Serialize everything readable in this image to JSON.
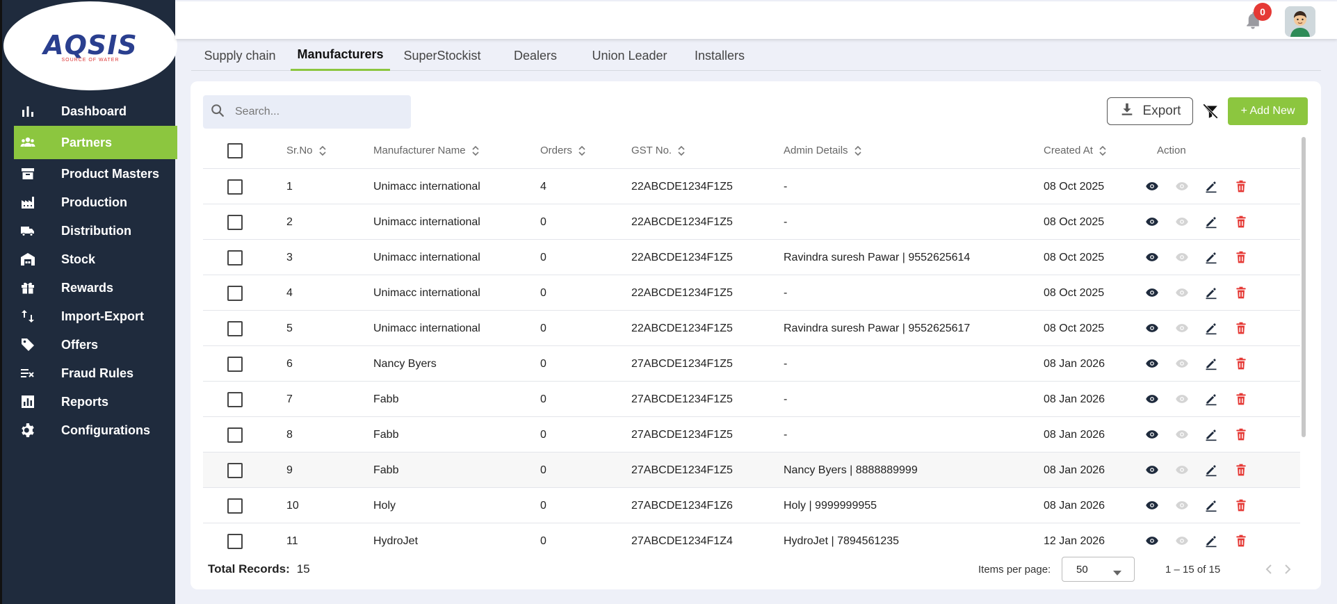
{
  "logo": {
    "text": "AQSIS",
    "tagline": "SOURCE OF WATER"
  },
  "sidebar": {
    "items": [
      {
        "label": "Dashboard",
        "icon": "bar-chart-icon"
      },
      {
        "label": "Partners",
        "icon": "group-icon",
        "active": true
      },
      {
        "label": "Product Masters",
        "icon": "archive-icon"
      },
      {
        "label": "Production",
        "icon": "factory-icon"
      },
      {
        "label": "Distribution",
        "icon": "truck-icon"
      },
      {
        "label": "Stock",
        "icon": "warehouse-icon"
      },
      {
        "label": "Rewards",
        "icon": "gift-icon"
      },
      {
        "label": "Import-Export",
        "icon": "import-export-icon"
      },
      {
        "label": "Offers",
        "icon": "tag-icon"
      },
      {
        "label": "Fraud Rules",
        "icon": "rule-icon"
      },
      {
        "label": "Reports",
        "icon": "report-icon"
      },
      {
        "label": "Configurations",
        "icon": "gear-icon"
      }
    ]
  },
  "topbar": {
    "notification_count": "0"
  },
  "tabs": [
    {
      "label": "Supply chain"
    },
    {
      "label": "Manufacturers",
      "active": true
    },
    {
      "label": "SuperStockist"
    },
    {
      "label": "Dealers"
    },
    {
      "label": "Union Leader"
    },
    {
      "label": "Installers"
    }
  ],
  "search": {
    "placeholder": "Search..."
  },
  "toolbar": {
    "export_label": "Export",
    "add_label": "+ Add New"
  },
  "table": {
    "columns": [
      "Sr.No",
      "Manufacturer Name",
      "Orders",
      "GST No.",
      "Admin Details",
      "Created At",
      "Action"
    ],
    "rows": [
      [
        "1",
        "Unimacc international",
        "4",
        "22ABCDE1234F1Z5",
        "-",
        "08 Oct 2025"
      ],
      [
        "2",
        "Unimacc international",
        "0",
        "22ABCDE1234F1Z5",
        "-",
        "08 Oct 2025"
      ],
      [
        "3",
        "Unimacc international",
        "0",
        "22ABCDE1234F1Z5",
        "Ravindra suresh Pawar | 9552625614",
        "08 Oct 2025"
      ],
      [
        "4",
        "Unimacc international",
        "0",
        "22ABCDE1234F1Z5",
        "-",
        "08 Oct 2025"
      ],
      [
        "5",
        "Unimacc international",
        "0",
        "22ABCDE1234F1Z5",
        "Ravindra suresh Pawar | 9552625617",
        "08 Oct 2025"
      ],
      [
        "6",
        "Nancy Byers",
        "0",
        "27ABCDE1234F1Z5",
        "-",
        "08 Jan 2026"
      ],
      [
        "7",
        "Fabb",
        "0",
        "27ABCDE1234F1Z5",
        "-",
        "08 Jan 2026"
      ],
      [
        "8",
        "Fabb",
        "0",
        "27ABCDE1234F1Z5",
        "-",
        "08 Jan 2026"
      ],
      [
        "9",
        "Fabb",
        "0",
        "27ABCDE1234F1Z5",
        "Nancy Byers | 8888889999",
        "08 Jan 2026"
      ],
      [
        "10",
        "Holy",
        "0",
        "27ABCDE1234F1Z6",
        "Holy | 9999999955",
        "08 Jan 2026"
      ],
      [
        "11",
        "HydroJet",
        "0",
        "27ABCDE1234F1Z4",
        "HydroJet | 7894561235",
        "12 Jan 2026"
      ]
    ]
  },
  "footer": {
    "total_label": "Total Records:",
    "total_value": "15",
    "items_per_page_label": "Items per page:",
    "items_per_page_value": "50",
    "range": "1 – 15 of 15"
  },
  "colors": {
    "sidebar_bg": "#1f2b3d",
    "accent_green": "#8cc63f",
    "delete_red": "#e53935"
  }
}
